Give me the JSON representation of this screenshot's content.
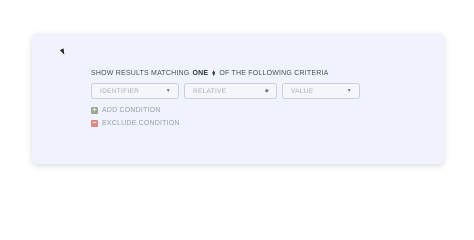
{
  "criteria": {
    "prefix": "SHOW RESULTS MATCHING",
    "match_value": "ONE",
    "suffix": "OF THE FOLLOWING CRITERIA"
  },
  "selects": [
    {
      "placeholder": "IDENTIFIER"
    },
    {
      "placeholder": "RELATIVE"
    },
    {
      "placeholder": "VALUE"
    }
  ],
  "actions": {
    "add_label": "ADD CONDITION",
    "exclude_label": "EXCLUDE CONDITION"
  },
  "icons": {
    "add": "plus-square-icon",
    "exclude": "minus-square-icon",
    "dropdown": "chevron-down-icon",
    "stepper": "up-down-stepper-icon"
  },
  "colors": {
    "card_background": "#f0f3fb",
    "add_icon": "#9aaa8f",
    "exclude_icon": "#d9888a"
  }
}
